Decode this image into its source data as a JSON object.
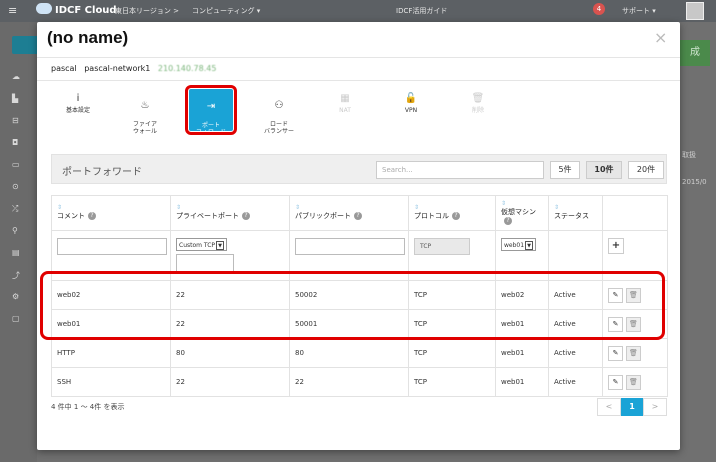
{
  "app": {
    "logo_text": "IDCF Cloud",
    "region": "東日本リージョン",
    "separator": ">",
    "service": "コンピューティング ▾",
    "guide": "IDCF活用ガイド",
    "notification_count": "4",
    "support": "サポート ▾",
    "right_button": "成",
    "right_labels": [
      "取扱",
      "2015/0"
    ]
  },
  "modal": {
    "title": "(no name)",
    "close": "×",
    "breadcrumb": {
      "account": "pascal",
      "network": "pascal-network1",
      "ip": "210.140.78.45"
    }
  },
  "toolbar": [
    {
      "label": "基本設定",
      "icon": "info-icon",
      "glyph": "i"
    },
    {
      "label": "ファイア\nウォール",
      "icon": "fire-icon",
      "glyph": "♨"
    },
    {
      "label": "ポート\nフォワード",
      "icon": "sign-in-icon",
      "glyph": "⇥"
    },
    {
      "label": "ロード\nバランサー",
      "icon": "sitemap-icon",
      "glyph": "⚇"
    },
    {
      "label": "NAT",
      "icon": "nat-icon",
      "glyph": "▦"
    },
    {
      "label": "VPN",
      "icon": "unlock-icon",
      "glyph": "🔓"
    },
    {
      "label": "削除",
      "icon": "trash-icon",
      "glyph": "🗑"
    }
  ],
  "panel": {
    "title": "ポートフォワード",
    "search_placeholder": "Search...",
    "page_sizes": [
      "5件",
      "10件",
      "20件"
    ],
    "active_page_size": "10件",
    "columns": [
      "コメント",
      "プライベートポート",
      "パブリックポート",
      "プロトコル",
      "仮想マシン",
      "ステータス"
    ],
    "new_row": {
      "private_port_select": "Custom TCP",
      "protocol": "TCP",
      "vm_select": "web01",
      "add_label": "+"
    },
    "rows": [
      {
        "comment": "web02",
        "private_port": "22",
        "public_port": "50002",
        "protocol": "TCP",
        "vm": "web02",
        "status": "Active"
      },
      {
        "comment": "web01",
        "private_port": "22",
        "public_port": "50001",
        "protocol": "TCP",
        "vm": "web01",
        "status": "Active"
      },
      {
        "comment": "HTTP",
        "private_port": "80",
        "public_port": "80",
        "protocol": "TCP",
        "vm": "web01",
        "status": "Active"
      },
      {
        "comment": "SSH",
        "private_port": "22",
        "public_port": "22",
        "protocol": "TCP",
        "vm": "web01",
        "status": "Active"
      }
    ],
    "footer": "4 件中 1 〜 4件 を表示",
    "pager": {
      "prev": "<",
      "current": "1",
      "next": ">"
    }
  },
  "colors": {
    "accent": "#1aa3d6",
    "status_active": "#5aa02c",
    "highlight": "#e00000"
  }
}
